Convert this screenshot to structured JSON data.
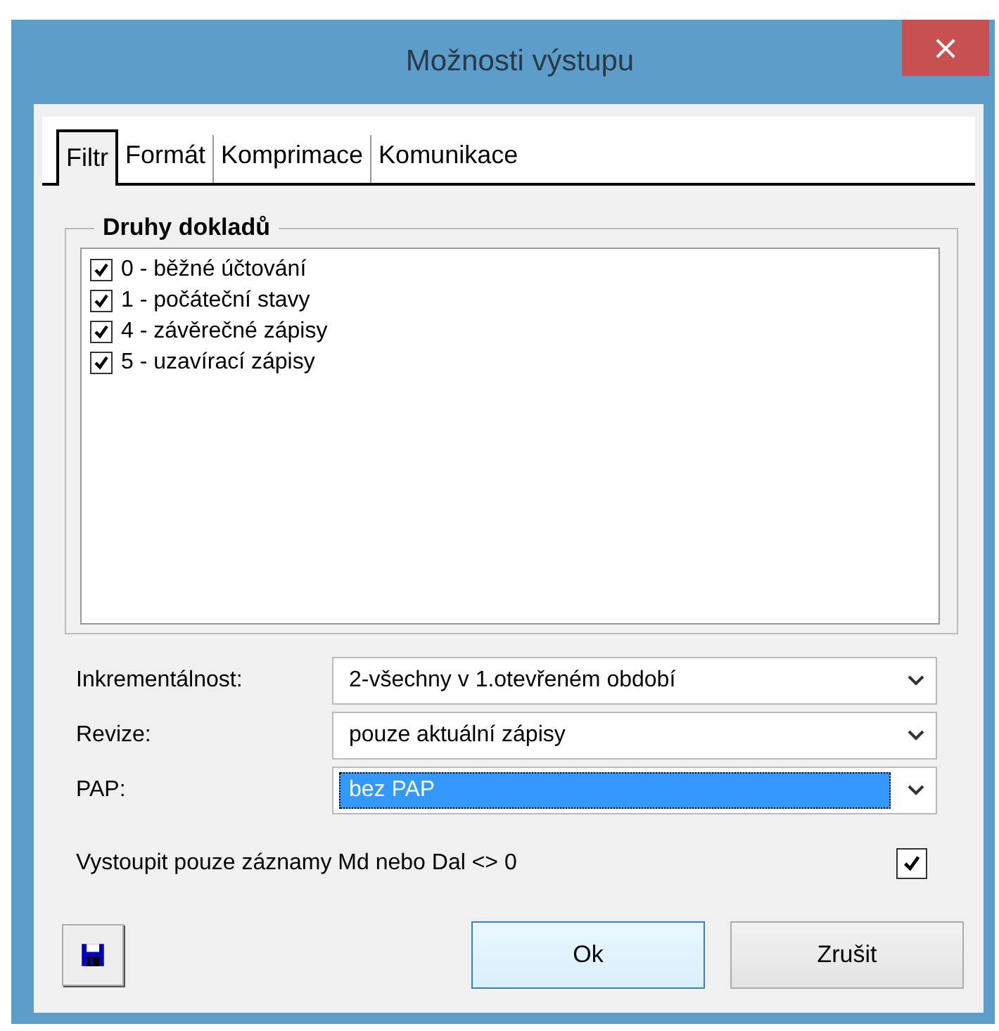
{
  "window": {
    "title": "Možnosti výstupu",
    "close": "×"
  },
  "tabs": [
    {
      "label": "Filtr",
      "selected": true
    },
    {
      "label": "Formát",
      "selected": false
    },
    {
      "label": "Komprimace",
      "selected": false
    },
    {
      "label": "Komunikace",
      "selected": false
    }
  ],
  "group": {
    "title": "Druhy dokladů",
    "items": [
      {
        "label": "0 - běžné účtování",
        "checked": true
      },
      {
        "label": "1 - počáteční stavy",
        "checked": true
      },
      {
        "label": "4 - závěrečné zápisy",
        "checked": true
      },
      {
        "label": "5 - uzavírací zápisy",
        "checked": true
      }
    ]
  },
  "fields": [
    {
      "label": "Inkrementálnost:",
      "value": "2-všechny v 1.otevřeném období",
      "focused": false
    },
    {
      "label": "Revize:",
      "value": "pouze aktuální zápisy",
      "focused": false
    },
    {
      "label": "PAP:",
      "value": "bez PAP",
      "focused": true
    }
  ],
  "option": {
    "label": "Vystoupit pouze záznamy Md nebo Dal <> 0",
    "checked": true
  },
  "buttons": [
    {
      "label": "Ok",
      "default": true
    },
    {
      "label": "Zrušit",
      "default": false
    }
  ]
}
